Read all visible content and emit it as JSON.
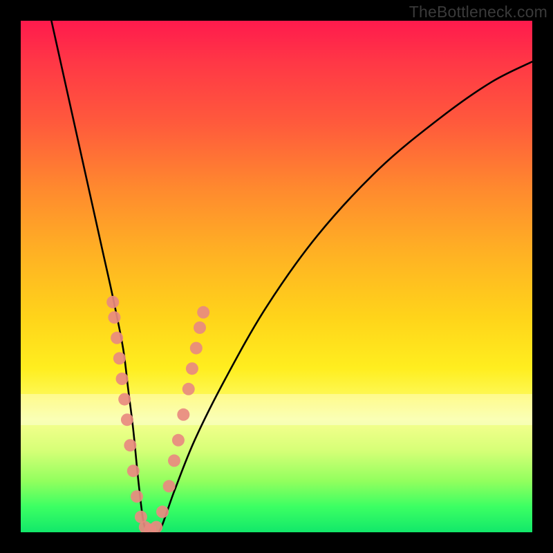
{
  "watermark": "TheBottleneck.com",
  "chart_data": {
    "type": "line",
    "title": "",
    "xlabel": "",
    "ylabel": "",
    "xlim": [
      0,
      100
    ],
    "ylim": [
      0,
      100
    ],
    "series": [
      {
        "name": "bottleneck-curve",
        "x": [
          6,
          8,
          10,
          12,
          14,
          16,
          18,
          20,
          21,
          22,
          23,
          24,
          25,
          27,
          30,
          34,
          40,
          48,
          58,
          70,
          82,
          92,
          100
        ],
        "values": [
          100,
          91,
          82,
          73,
          64,
          55,
          46,
          36,
          28,
          20,
          10,
          2,
          0,
          0,
          8,
          18,
          30,
          44,
          58,
          71,
          81,
          88,
          92
        ]
      }
    ],
    "scatter": {
      "name": "highlight-dots",
      "color": "#e88a80",
      "points": [
        {
          "x": 18.0,
          "y": 45
        },
        {
          "x": 18.3,
          "y": 42
        },
        {
          "x": 18.8,
          "y": 38
        },
        {
          "x": 19.3,
          "y": 34
        },
        {
          "x": 19.8,
          "y": 30
        },
        {
          "x": 20.3,
          "y": 26
        },
        {
          "x": 20.8,
          "y": 22
        },
        {
          "x": 21.4,
          "y": 17
        },
        {
          "x": 22.0,
          "y": 12
        },
        {
          "x": 22.7,
          "y": 7
        },
        {
          "x": 23.5,
          "y": 3
        },
        {
          "x": 24.3,
          "y": 1
        },
        {
          "x": 25.3,
          "y": 0.5
        },
        {
          "x": 26.5,
          "y": 1
        },
        {
          "x": 27.7,
          "y": 4
        },
        {
          "x": 29.0,
          "y": 9
        },
        {
          "x": 30.0,
          "y": 14
        },
        {
          "x": 30.8,
          "y": 18
        },
        {
          "x": 31.8,
          "y": 23
        },
        {
          "x": 32.8,
          "y": 28
        },
        {
          "x": 33.5,
          "y": 32
        },
        {
          "x": 34.3,
          "y": 36
        },
        {
          "x": 35.0,
          "y": 40
        },
        {
          "x": 35.7,
          "y": 43
        }
      ]
    },
    "pale_band": {
      "y_from": 21,
      "y_to": 27
    }
  }
}
